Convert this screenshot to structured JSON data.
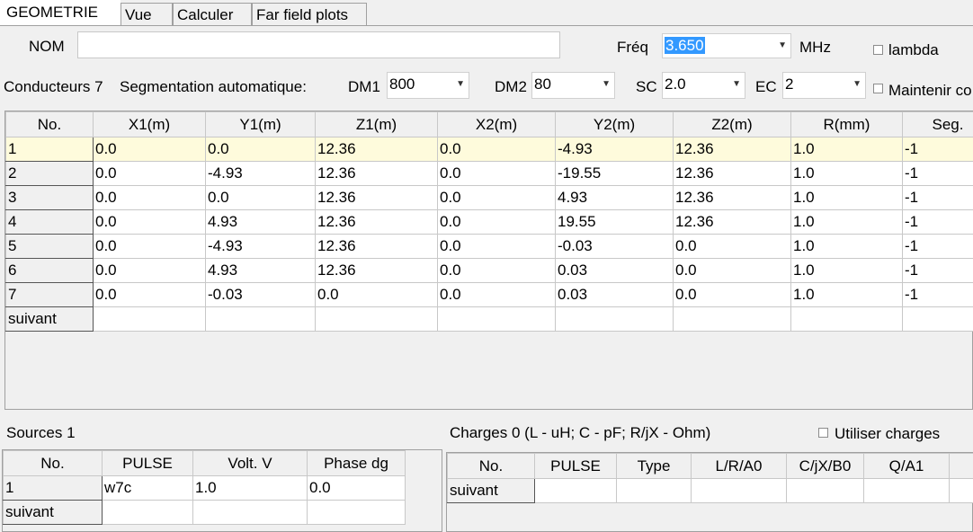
{
  "tabs": [
    "GEOMETRIE",
    "Vue",
    "Calculer",
    "Far field plots"
  ],
  "nom_label": "NOM",
  "nom_value": "",
  "freq_label": "Fréq",
  "freq_value": "3.650",
  "freq_unit": "MHz",
  "lambda_label": "lambda",
  "conducteurs_label": "Conducteurs 7",
  "segmentation_label": "Segmentation automatique:",
  "dm1_label": "DM1",
  "dm1_value": "800",
  "dm2_label": "DM2",
  "dm2_value": "80",
  "sc_label": "SC",
  "sc_value": "2.0",
  "ec_label": "EC",
  "ec_value": "2",
  "maintenir_label": "Maintenir co",
  "wires": {
    "headers": [
      "No.",
      "X1(m)",
      "Y1(m)",
      "Z1(m)",
      "X2(m)",
      "Y2(m)",
      "Z2(m)",
      "R(mm)",
      "Seg."
    ],
    "rows": [
      [
        "1",
        "0.0",
        "0.0",
        "12.36",
        "0.0",
        "-4.93",
        "12.36",
        "1.0",
        "-1"
      ],
      [
        "2",
        "0.0",
        "-4.93",
        "12.36",
        "0.0",
        "-19.55",
        "12.36",
        "1.0",
        "-1"
      ],
      [
        "3",
        "0.0",
        "0.0",
        "12.36",
        "0.0",
        "4.93",
        "12.36",
        "1.0",
        "-1"
      ],
      [
        "4",
        "0.0",
        "4.93",
        "12.36",
        "0.0",
        "19.55",
        "12.36",
        "1.0",
        "-1"
      ],
      [
        "5",
        "0.0",
        "-4.93",
        "12.36",
        "0.0",
        "-0.03",
        "0.0",
        "1.0",
        "-1"
      ],
      [
        "6",
        "0.0",
        "4.93",
        "12.36",
        "0.0",
        "0.03",
        "0.0",
        "1.0",
        "-1"
      ],
      [
        "7",
        "0.0",
        "-0.03",
        "0.0",
        "0.0",
        "0.03",
        "0.0",
        "1.0",
        "-1"
      ],
      [
        "suivant",
        "",
        "",
        "",
        "",
        "",
        "",
        "",
        ""
      ]
    ]
  },
  "sources_label": "Sources 1",
  "sources": {
    "headers": [
      "No.",
      "PULSE",
      "Volt. V",
      "Phase dg"
    ],
    "rows": [
      [
        "1",
        "w7c",
        "1.0",
        "0.0"
      ],
      [
        "suivant",
        "",
        "",
        ""
      ]
    ]
  },
  "charges_label": "Charges 0 (L - uH; C - pF; R/jX - Ohm)",
  "utiliser_charges_label": "Utiliser charges",
  "charges": {
    "headers": [
      "No.",
      "PULSE",
      "Type",
      "L/R/A0",
      "C/jX/B0",
      "Q/A1",
      ""
    ],
    "rows": [
      [
        "suivant",
        "",
        "",
        "",
        "",
        "",
        ""
      ]
    ]
  }
}
